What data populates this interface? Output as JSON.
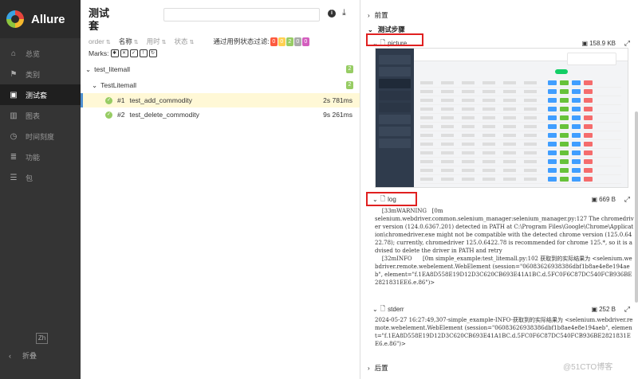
{
  "brand": {
    "name": "Allure"
  },
  "sidebar": {
    "items": [
      {
        "icon": "home-icon",
        "glyph": "⌂",
        "label": "总览"
      },
      {
        "icon": "flag-icon",
        "glyph": "⚑",
        "label": "类别"
      },
      {
        "icon": "briefcase-icon",
        "glyph": "▣",
        "label": "测试套",
        "active": true
      },
      {
        "icon": "bar-chart-icon",
        "glyph": "▥",
        "label": "图表"
      },
      {
        "icon": "clock-icon",
        "glyph": "◷",
        "label": "时间刻度"
      },
      {
        "icon": "list-icon",
        "glyph": "≣",
        "label": "功能"
      },
      {
        "icon": "package-icon",
        "glyph": "☰",
        "label": "包"
      }
    ],
    "lang": "Zh",
    "collapse": "折叠"
  },
  "suites": {
    "title": "测试套",
    "sort": {
      "order": "order",
      "name": "名称",
      "duration": "用时",
      "status": "状态"
    },
    "filter_label": "通过用例状态过滤:",
    "status_counts": [
      {
        "value": "0",
        "color": "#fd5a3e"
      },
      {
        "value": "0",
        "color": "#ffd050"
      },
      {
        "value": "2",
        "color": "#97cc64"
      },
      {
        "value": "0",
        "color": "#aaaaaa"
      },
      {
        "value": "0",
        "color": "#d35ebe"
      }
    ],
    "marks_label": "Marks:",
    "tree": {
      "root": {
        "label": "test_litemall",
        "count": "2"
      },
      "child": {
        "label": "TestLitemall",
        "count": "2"
      },
      "cases": [
        {
          "num": "#1",
          "name": "test_add_commodity",
          "duration": "2s 781ms"
        },
        {
          "num": "#2",
          "name": "test_delete_commodity",
          "duration": "9s 261ms"
        }
      ]
    }
  },
  "detail": {
    "setup": "前置",
    "steps": "测试步骤",
    "picture": {
      "name": "picture",
      "size": "158.9 KB"
    },
    "log": {
      "name": "log",
      "size": "669 B",
      "text": "    [33mWARNING   [0m\nselenium.webdriver.common.selenium_manager:selenium_manager.py:127 The chromedriver version (124.0.6367.201) detected in PATH at C:\\Program Files\\Google\\Chrome\\Application\\chromedriver.exe might not be compatible with the detected chrome version (125.0.6422.78); currently, chromedriver 125.0.6422.78 is recommended for chrome 125.*, so it is advised to delete the driver in PATH and retry\n    [32mINFO      [0m simple_example:test_litemall.py:102 获取到的实际结果为 <selenium.webdriver.remote.webelement.WebElement (session=\"06083626938386dbf1b8ae4e8e194aeb\", element=\"f.1EA8D558E19D12D3C620CB693E41A1BC.d.5FC0F6C87DC540FCB936BE2821831EE6.e.86\")>"
    },
    "stderr": {
      "name": "stderr",
      "size": "252 B",
      "text": "2024-05-27 16:27:49,307-simple_example-INFO-获取到的实际结果为 <selenium.webdriver.remote.webelement.WebElement (session=\"06083626938386dbf1b8ae4e8e194aeb\", element=\"f.1EA8D558E19D12D3C620CB693E41A1BC.d.5FC0F6C87DC540FCB936BE2821831EE6.e.86\")>"
    },
    "teardown": "后置"
  },
  "watermark": "@51CTO博客"
}
